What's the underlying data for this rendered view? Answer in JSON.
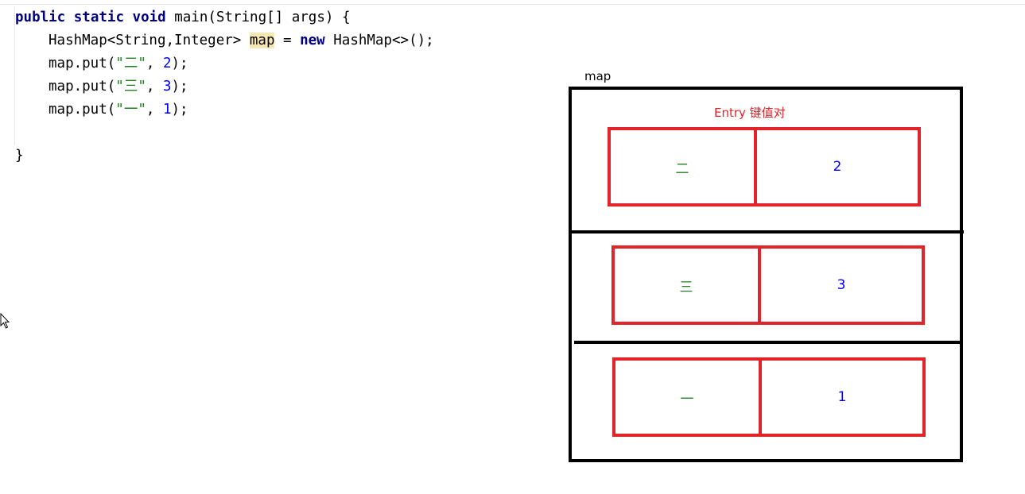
{
  "code": {
    "line1": {
      "kw1": "public",
      "kw2": "static",
      "kw3": "void",
      "rest": "main(String[] args) {"
    },
    "line2": {
      "type": "HashMap<String,Integer>",
      "var": "map",
      "eq": " = ",
      "kw": "new",
      "rest": "HashMap<>();"
    },
    "line3": {
      "pre": "map.put(",
      "str": "\"二\"",
      "sep": ", ",
      "num": "2",
      "post": ");"
    },
    "line4": {
      "pre": "map.put(",
      "str": "\"三\"",
      "sep": ", ",
      "num": "3",
      "post": ");"
    },
    "line5": {
      "pre": "map.put(",
      "str": "\"一\"",
      "sep": ", ",
      "num": "1",
      "post": ");"
    },
    "line7": "}"
  },
  "diagram": {
    "map_label": "map",
    "entry_title": "Entry 键值对",
    "entries": [
      {
        "key": "二",
        "value": "2"
      },
      {
        "key": "三",
        "value": "3"
      },
      {
        "key": "一",
        "value": "1"
      }
    ]
  },
  "colors": {
    "keyword": "#00007f",
    "string": "#237f23",
    "number": "#0000ff",
    "highlight": "#f6e8b4",
    "entry_border": "#e0242a",
    "map_border": "#000000"
  }
}
